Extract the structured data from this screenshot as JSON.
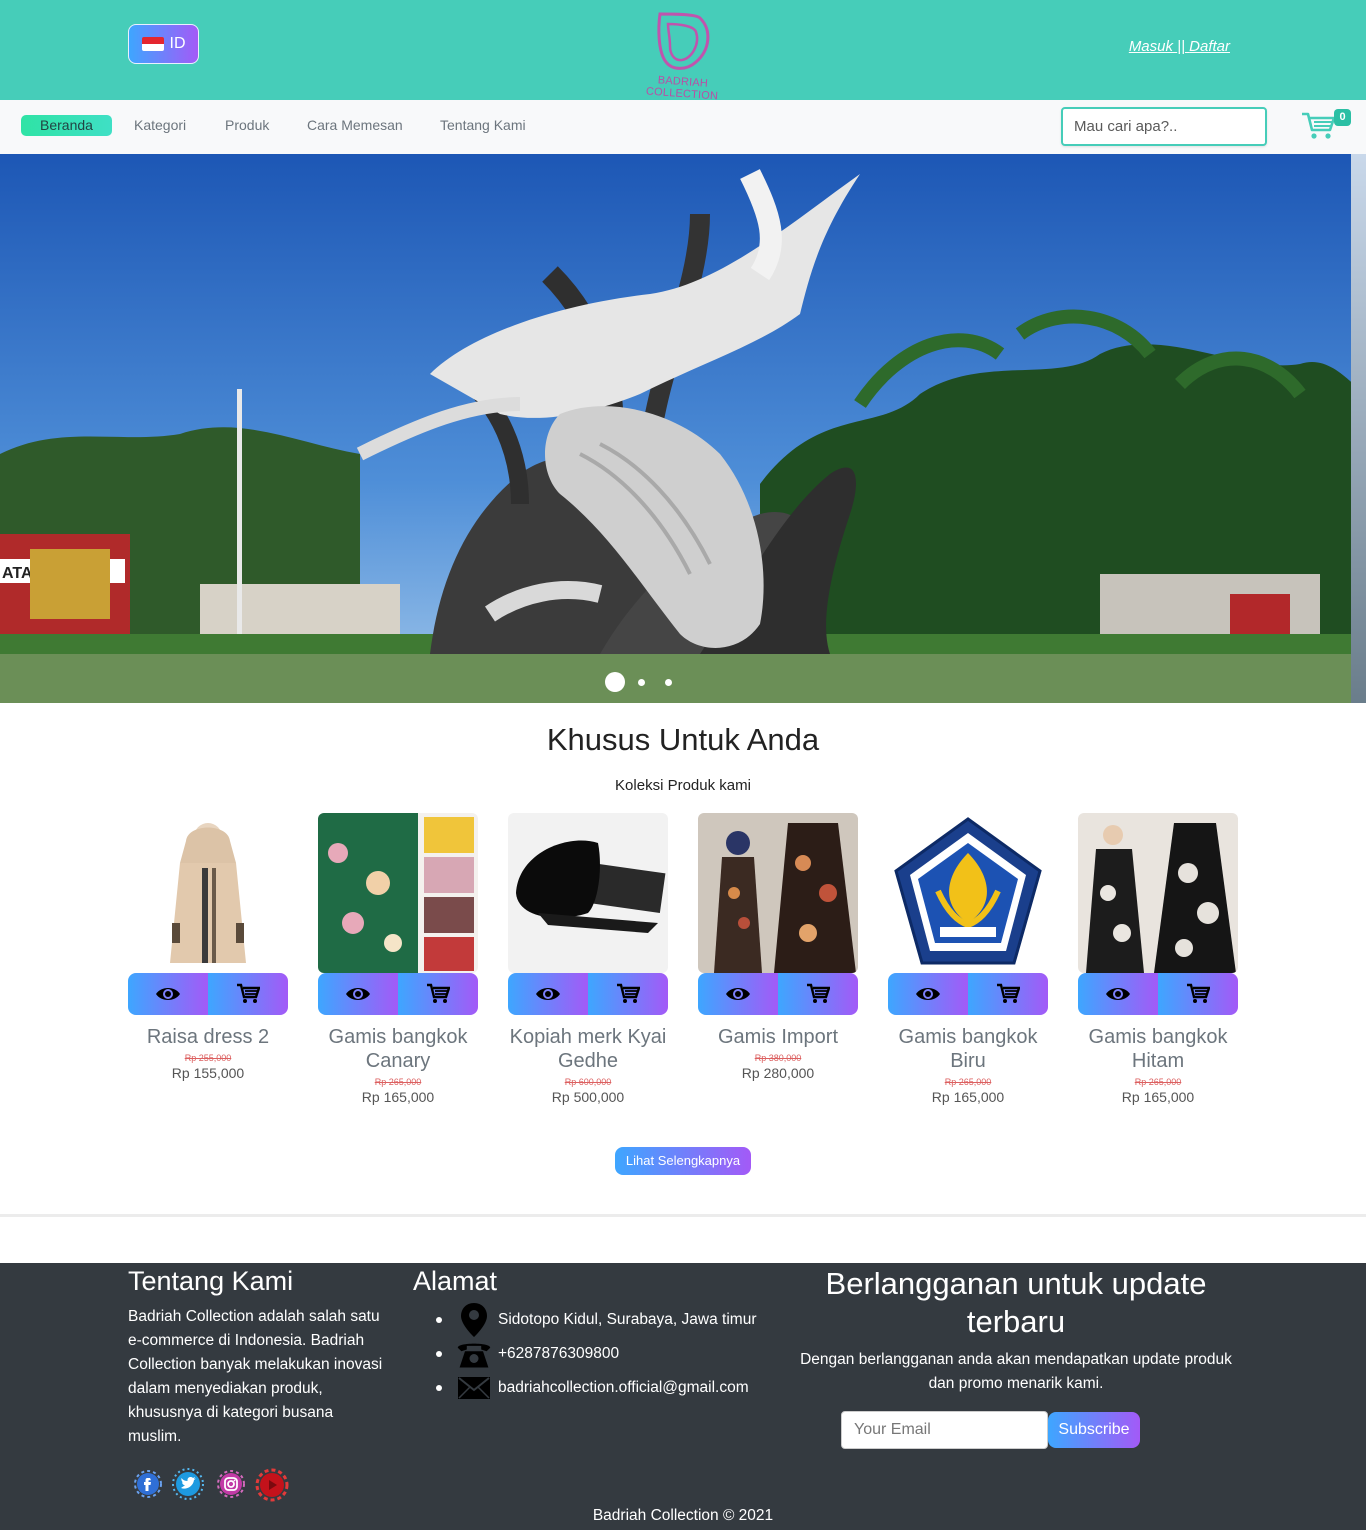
{
  "header": {
    "lang_label": "ID",
    "logo_text": "BADRIAH COLLECTION",
    "login_label": "Masuk",
    "separator": "||",
    "register_label": "Daftar"
  },
  "nav": {
    "items": [
      {
        "label": "Beranda",
        "active": true
      },
      {
        "label": "Kategori",
        "active": false
      },
      {
        "label": "Produk",
        "active": false
      },
      {
        "label": "Cara Memesan",
        "active": false
      },
      {
        "label": "Tentang Kami",
        "active": false
      }
    ],
    "search_placeholder": "Mau cari apa?..",
    "cart_count": "0"
  },
  "hero": {
    "slide_count": 3,
    "active_slide": 1,
    "sign_text": "ATANG"
  },
  "section": {
    "title": "Khusus Untuk Anda",
    "subtitle": "Koleksi Produk kami",
    "more_label": "Lihat Selengkapnya",
    "products": [
      {
        "name": "Raisa dress 2",
        "old_price": "Rp 255,000",
        "price": "Rp 155,000"
      },
      {
        "name": "Gamis bangkok Canary",
        "old_price": "Rp 265,000",
        "price": "Rp 165,000"
      },
      {
        "name": "Kopiah merk Kyai Gedhe",
        "old_price": "Rp 600,000",
        "price": "Rp 500,000"
      },
      {
        "name": "Gamis Import",
        "old_price": "Rp 380,000",
        "price": "Rp 280,000"
      },
      {
        "name": "Gamis bangkok Biru",
        "old_price": "Rp 265,000",
        "price": "Rp 165,000"
      },
      {
        "name": "Gamis bangkok Hitam",
        "old_price": "Rp 265,000",
        "price": "Rp 165,000"
      }
    ]
  },
  "footer": {
    "about_title": "Tentang Kami",
    "about_text": "Badriah Collection adalah salah satu e-commerce di Indonesia. Badriah Collection banyak melakukan inovasi dalam menyediakan produk, khususnya di kategori busana muslim.",
    "address_title": "Alamat",
    "address": "Sidotopo Kidul, Surabaya, Jawa timur",
    "phone": "+6287876309800",
    "email": "badriahcollection.official@gmail.com",
    "subscribe_title": "Berlangganan untuk update terbaru",
    "subscribe_text": "Dengan berlangganan anda akan mendapatkan update produk dan promo menarik kami.",
    "email_placeholder": "Your Email",
    "subscribe_label": "Subscribe",
    "copyright": "Badriah Collection © 2021"
  },
  "colors": {
    "header_bg": "#46cdb9",
    "gradient_start": "#3ea6ff",
    "gradient_end": "#a35af7",
    "footer_bg": "#343a40"
  }
}
